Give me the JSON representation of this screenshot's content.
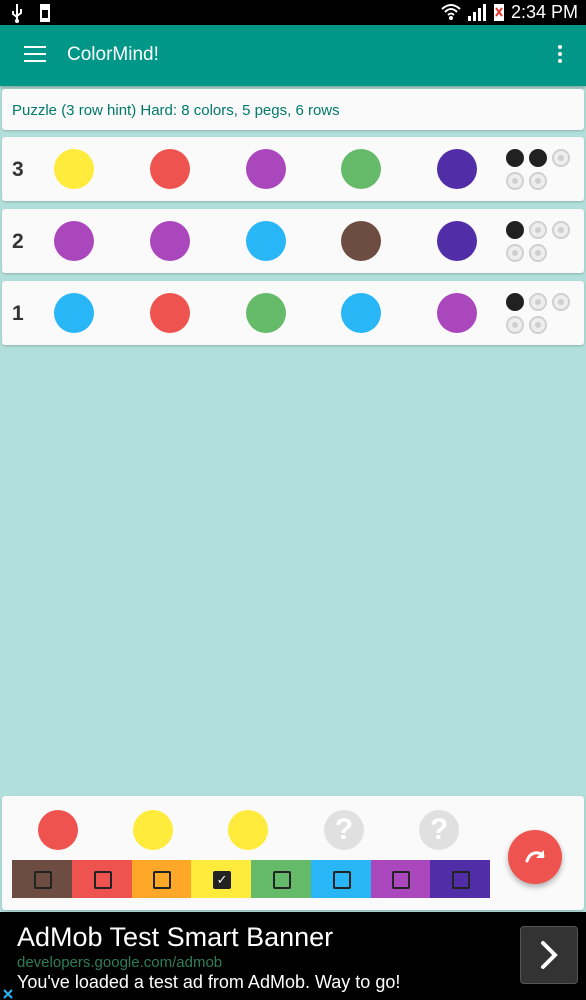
{
  "status_bar": {
    "time": "2:34 PM"
  },
  "app_bar": {
    "title": "ColorMind!"
  },
  "info": {
    "text": "Puzzle (3 row hint) Hard: 8 colors, 5 pegs, 6 rows"
  },
  "colors": {
    "yellow": "#ffeb3b",
    "red": "#ef5350",
    "purple": "#ab47bc",
    "green": "#66bb6a",
    "indigo": "#512da8",
    "brown": "#6d4c41",
    "lightblue": "#29b6f6",
    "orange": "#ffa726",
    "appbar": "#009688",
    "background": "#b2dfdb"
  },
  "rows": [
    {
      "number": "3",
      "pegs": [
        "yellow",
        "red",
        "purple",
        "green",
        "indigo"
      ],
      "feedback": {
        "black": 2,
        "white": 0,
        "total": 5
      }
    },
    {
      "number": "2",
      "pegs": [
        "purple",
        "purple",
        "lightblue",
        "brown",
        "indigo"
      ],
      "feedback": {
        "black": 1,
        "white": 0,
        "total": 5
      }
    },
    {
      "number": "1",
      "pegs": [
        "lightblue",
        "red",
        "green",
        "lightblue",
        "purple"
      ],
      "feedback": {
        "black": 1,
        "white": 0,
        "total": 5
      }
    }
  ],
  "current_guess": {
    "pegs": [
      "red",
      "yellow",
      "yellow",
      "?",
      "?"
    ]
  },
  "palette": {
    "swatches": [
      "brown",
      "red",
      "orange",
      "yellow",
      "green",
      "lightblue",
      "purple",
      "indigo"
    ],
    "checked": "yellow"
  },
  "ad": {
    "title": "AdMob Test Smart Banner",
    "url": "developers.google.com/admob",
    "description": "You've loaded a test ad from AdMob. Way to go!"
  },
  "icons": {
    "menu": "hamburger-menu-icon",
    "overflow": "more-vert-icon",
    "fab": "redo-arrow-icon",
    "ad_arrow": "chevron-right-icon"
  }
}
